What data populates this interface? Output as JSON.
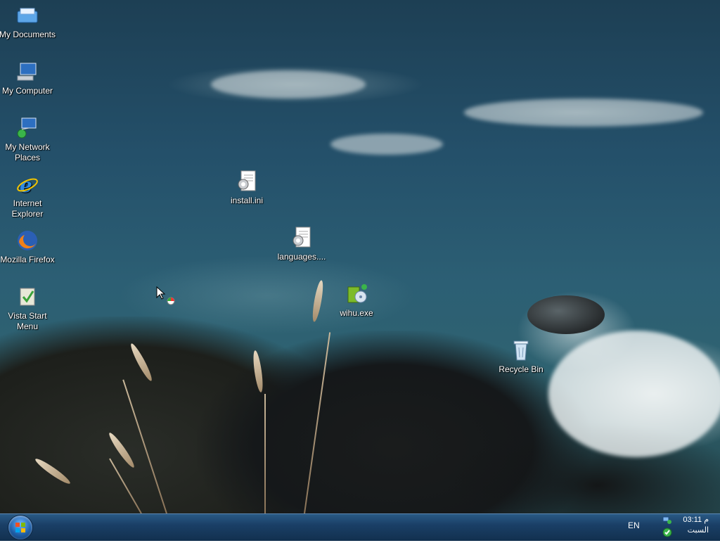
{
  "desktop": {
    "icons": [
      {
        "label": "My Documents",
        "icon": "folder-documents-icon"
      },
      {
        "label": "My Computer",
        "icon": "computer-icon"
      },
      {
        "label": "My Network Places",
        "icon": "network-icon"
      },
      {
        "label": "Internet Explorer",
        "icon": "internet-explorer-icon"
      },
      {
        "label": "Mozilla Firefox",
        "icon": "firefox-icon"
      },
      {
        "label": "Vista Start Menu",
        "icon": "vista-start-menu-icon"
      },
      {
        "label": "install.ini",
        "icon": "ini-file-icon"
      },
      {
        "label": "languages....",
        "icon": "ini-file-icon"
      },
      {
        "label": "wihu.exe",
        "icon": "installer-exe-icon"
      },
      {
        "label": "Recycle Bin",
        "icon": "recycle-bin-icon"
      }
    ]
  },
  "taskbar": {
    "language": "EN",
    "clock_time": "03:11 م",
    "clock_day": "السبت"
  },
  "colors": {
    "taskbar": "#1a3f66",
    "icon_text": "#ffffff"
  }
}
